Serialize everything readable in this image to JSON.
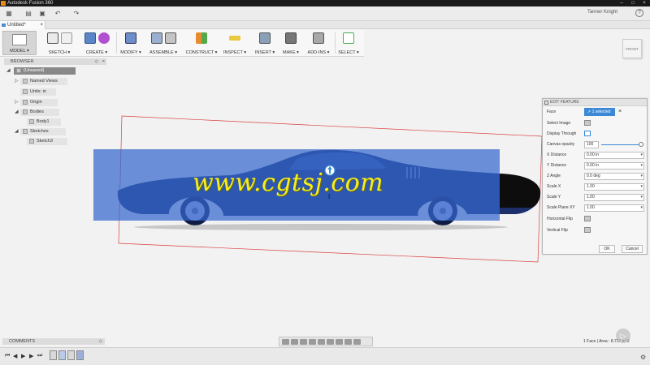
{
  "window": {
    "title": "Autodesk Fusion 360"
  },
  "quickbar": {
    "user_name": "Tanner Knight",
    "help": "?"
  },
  "document_tab": {
    "name": "Untitled*",
    "close": "×"
  },
  "toolbar": {
    "model_label": "MODEL ▾",
    "groups": [
      {
        "label": "SKETCH ▾"
      },
      {
        "label": "CREATE ▾"
      },
      {
        "label": "MODIFY ▾"
      },
      {
        "label": "ASSEMBLE ▾"
      },
      {
        "label": "CONSTRUCT ▾"
      },
      {
        "label": "INSPECT ▾"
      },
      {
        "label": "INSERT ▾"
      },
      {
        "label": "MAKE ▾"
      },
      {
        "label": "ADD-INS ▾"
      },
      {
        "label": "SELECT ▾"
      }
    ]
  },
  "browser": {
    "title": "BROWSER",
    "items": [
      {
        "label": "(Unsaved)"
      },
      {
        "label": "Named Views"
      },
      {
        "label": "Units: in"
      },
      {
        "label": "Origin"
      },
      {
        "label": "Bodies"
      },
      {
        "label": "Body1"
      },
      {
        "label": "Sketches"
      },
      {
        "label": "Sketch3"
      }
    ]
  },
  "viewcube": {
    "label": "FRONT"
  },
  "watermark": "www.cgtsj.com",
  "edit_feature": {
    "title": "EDIT FEATURE",
    "face_label": "Face",
    "face_value": "1 selected",
    "clear_selection": "×",
    "select_image_label": "Select Image",
    "display_through_label": "Display Through",
    "canvas_opacity_label": "Canvas opacity",
    "canvas_opacity_value": "100",
    "canvas_opacity_fraction": 1.0,
    "fields": [
      {
        "label": "X Distance",
        "value": "0.00 in"
      },
      {
        "label": "Y Distance",
        "value": "0.00 in"
      },
      {
        "label": "Z Angle",
        "value": "0.0 deg"
      },
      {
        "label": "Scale X",
        "value": "1.00"
      },
      {
        "label": "Scale Y",
        "value": "1.00"
      },
      {
        "label": "Scale Plane XY",
        "value": "1.00"
      }
    ],
    "horizontal_flip_label": "Horizontal Flip",
    "vertical_flip_label": "Vertical Flip",
    "ok_label": "OK",
    "cancel_label": "Cancel"
  },
  "comments": {
    "title": "COMMENTS"
  },
  "status": {
    "text": "1 Face | Area : 8.737 in^2"
  },
  "colors": {
    "canvas_tint": "#3466cd",
    "watermark": "#f6ee1c",
    "selection_blue": "#3c8ad6",
    "sketch_line": "#d94040"
  }
}
